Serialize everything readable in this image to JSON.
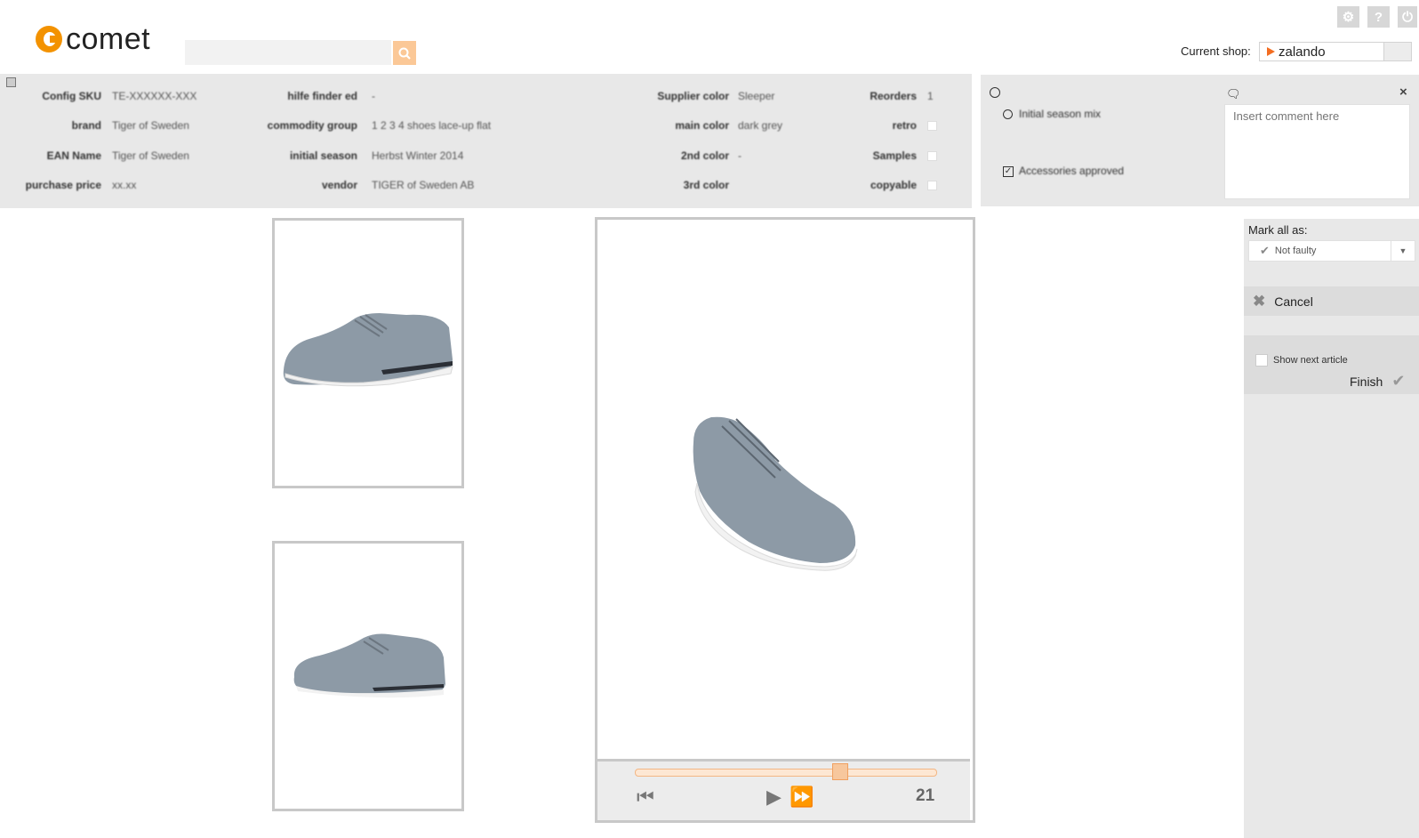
{
  "header": {
    "logo_text": "comet",
    "search_placeholder": "",
    "current_shop_label": "Current shop:",
    "current_shop_value": "zalando"
  },
  "info_panel": {
    "rows": [
      {
        "label": "Config SKU",
        "value": "TE-XXXXXX-XXX"
      },
      {
        "label": "brand",
        "value": "Tiger of Sweden"
      },
      {
        "label": "EAN Name",
        "value": "Tiger of Sweden"
      },
      {
        "label": "purchase price",
        "value": "xx.xx"
      }
    ],
    "col2": [
      {
        "label": "hilfe finder ed",
        "value": "-"
      },
      {
        "label": "commodity group",
        "value": "1 2 3 4 shoes lace-up flat"
      },
      {
        "label": "initial season",
        "value": "Herbst Winter 2014"
      },
      {
        "label": "vendor",
        "value": "TIGER of Sweden AB"
      }
    ],
    "col3": [
      {
        "label": "Supplier color",
        "value": "Sleeper"
      },
      {
        "label": "main color",
        "value": "dark grey"
      },
      {
        "label": "2nd color",
        "value": "-"
      },
      {
        "label": "3rd color",
        "value": ""
      }
    ],
    "col4": [
      {
        "label": "Reorders",
        "value": "1"
      },
      {
        "label": "retro",
        "value": ""
      },
      {
        "label": "Samples",
        "value": ""
      },
      {
        "label": "copyable",
        "value": ""
      }
    ]
  },
  "comment_panel": {
    "option1": "Initial season mix",
    "option2": "Accessories approved",
    "comment_placeholder": "Insert comment here"
  },
  "viewer": {
    "frame_number": "21",
    "slider_position": 0.68
  },
  "sidebar": {
    "mark_all_label": "Mark all as:",
    "mark_all_value": "Not faulty",
    "cancel_label": "Cancel",
    "show_next_label": "Show next article",
    "finish_label": "Finish"
  },
  "colors": {
    "accent": "#f39200",
    "panel_bg": "#e8e8e8",
    "shoe": "#8d9aa6"
  }
}
